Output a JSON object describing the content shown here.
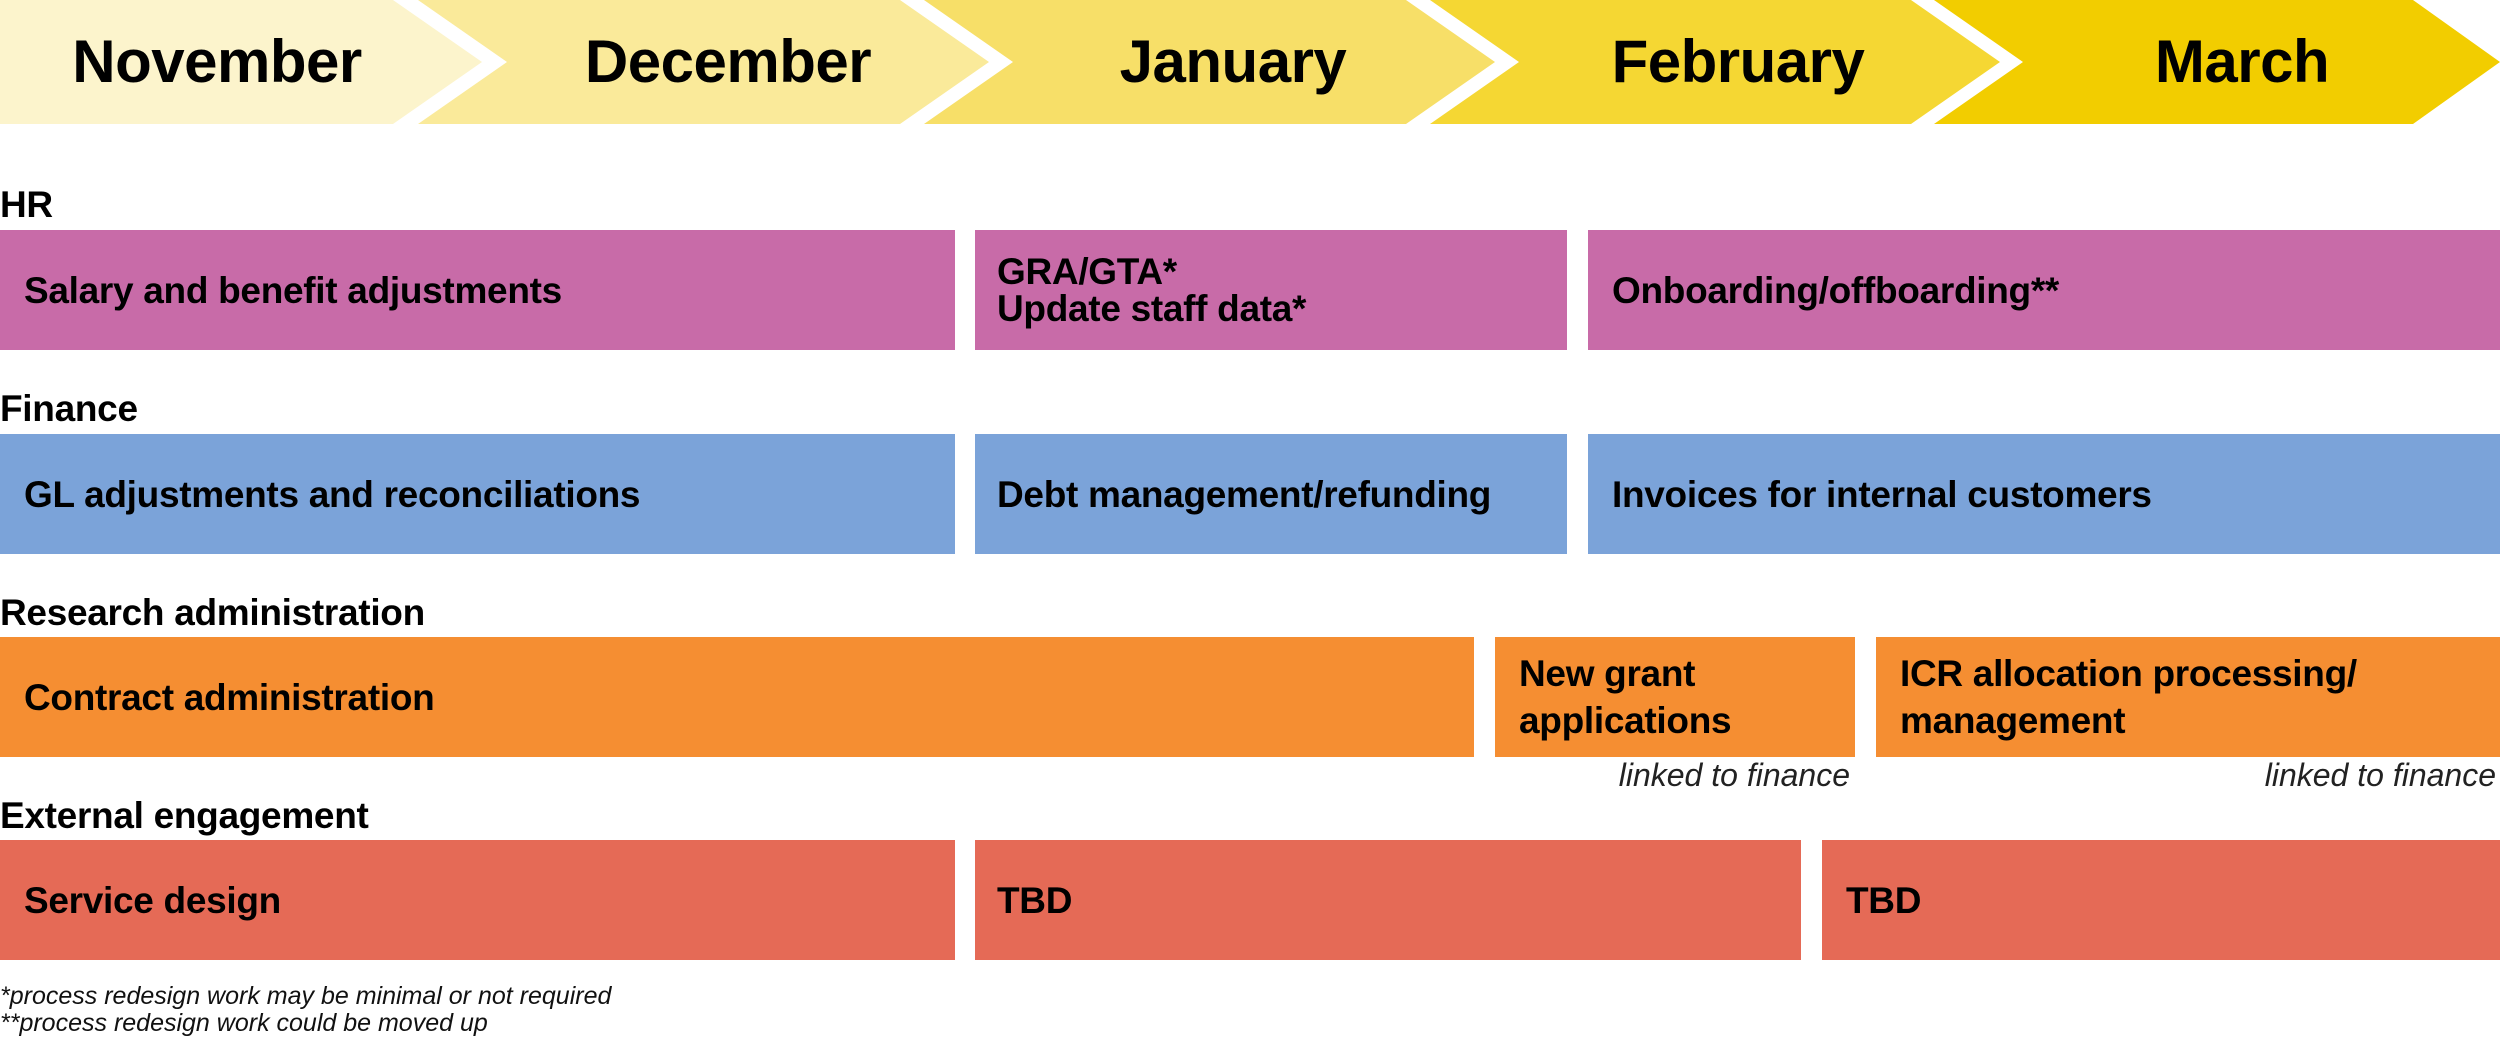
{
  "timeline": {
    "months": [
      {
        "label": "November",
        "color": "#FCF4CC"
      },
      {
        "label": "December",
        "color": "#FAEA9A"
      },
      {
        "label": "January",
        "color": "#F7DF68"
      },
      {
        "label": "February",
        "color": "#F5D733"
      },
      {
        "label": "March",
        "color": "#F2CD00"
      }
    ]
  },
  "sections": [
    {
      "label": "HR",
      "color": "#C86BA8",
      "items": [
        {
          "lines": [
            "Salary and benefit adjustments"
          ],
          "months": "November–December"
        },
        {
          "lines": [
            "GRA/GTA*",
            "Update staff data*"
          ],
          "months": "January"
        },
        {
          "lines": [
            "Onboarding/offboarding**"
          ],
          "months": "February–March"
        }
      ]
    },
    {
      "label": "Finance",
      "color": "#7BA3D9",
      "items": [
        {
          "lines": [
            "GL adjustments and reconciliations"
          ],
          "months": "November–December"
        },
        {
          "lines": [
            "Debt management/refunding"
          ],
          "months": "January"
        },
        {
          "lines": [
            "Invoices for internal customers"
          ],
          "months": "February–March"
        }
      ]
    },
    {
      "label": "Research administration",
      "color": "#F58E32",
      "items": [
        {
          "lines": [
            "Contract administration"
          ],
          "months": "November–mid January"
        },
        {
          "lines": [
            "New grant",
            "applications"
          ],
          "note": "linked to finance",
          "months": "mid January–mid February"
        },
        {
          "lines": [
            "ICR allocation processing/",
            "management"
          ],
          "note": "linked to finance",
          "months": "mid February–March"
        }
      ]
    },
    {
      "label": "External engagement",
      "color": "#E56A56",
      "items": [
        {
          "lines": [
            "Service design"
          ],
          "months": "November–December"
        },
        {
          "lines": [
            "TBD"
          ],
          "months": "January–mid February"
        },
        {
          "lines": [
            "TBD"
          ],
          "months": "mid February–March"
        }
      ]
    }
  ],
  "footnotes": [
    "*process redesign work may be minimal or not required",
    "**process redesign work could be moved up"
  ]
}
